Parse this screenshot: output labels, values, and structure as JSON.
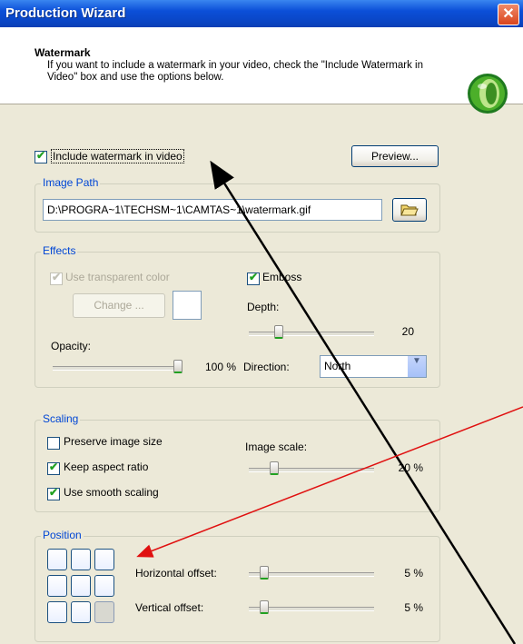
{
  "window": {
    "title": "Production Wizard",
    "close_glyph": "✕"
  },
  "header": {
    "title": "Watermark",
    "description": "If you want to include a watermark in your video, check the \"Include Watermark in Video\" box and use the options below.",
    "logo_icon": "camtasia-logo-icon"
  },
  "include": {
    "label": "Include watermark in video",
    "checked": true
  },
  "preview_button": "Preview...",
  "image_path": {
    "group_label": "Image Path",
    "value": "D:\\PROGRA~1\\TECHSM~1\\CAMTAS~1\\watermark.gif",
    "browse_icon": "folder-open-icon"
  },
  "effects": {
    "group_label": "Effects",
    "use_transparent": {
      "label": "Use transparent color",
      "checked": true,
      "enabled": false
    },
    "change_button": "Change ...",
    "emboss": {
      "label": "Emboss",
      "checked": true
    },
    "depth": {
      "label": "Depth:",
      "value": "20"
    },
    "opacity": {
      "label": "Opacity:",
      "value": "100 %"
    },
    "direction": {
      "label": "Direction:",
      "value": "North"
    }
  },
  "scaling": {
    "group_label": "Scaling",
    "preserve": {
      "label": "Preserve image size",
      "checked": false
    },
    "keep_aspect": {
      "label": "Keep aspect ratio",
      "checked": true
    },
    "smooth": {
      "label": "Use smooth scaling",
      "checked": true
    },
    "image_scale": {
      "label": "Image scale:",
      "value": "20 %"
    }
  },
  "position": {
    "group_label": "Position",
    "horizontal": {
      "label": "Horizontal offset:",
      "value": "5 %"
    },
    "vertical": {
      "label": "Vertical offset:",
      "value": "5 %"
    },
    "selected_cell": "bottom-right"
  },
  "colors": {
    "title_bar": "#0b4fd8",
    "group_label": "#0046d5",
    "check": "#21a121",
    "arrow_black": "#000000",
    "arrow_red": "#e01010"
  }
}
